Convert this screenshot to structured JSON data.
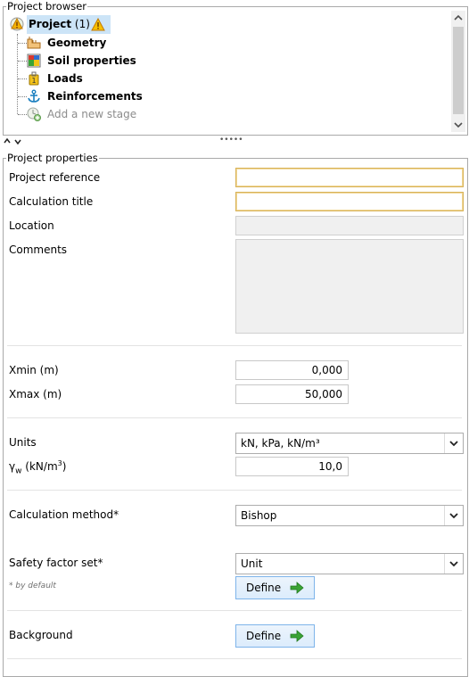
{
  "project_browser": {
    "legend": "Project browser",
    "root": {
      "label": "Project",
      "count": "(1)"
    },
    "items": [
      {
        "label": "Geometry",
        "icon": "geometry-icon"
      },
      {
        "label": "Soil properties",
        "icon": "soil-properties-icon"
      },
      {
        "label": "Loads",
        "icon": "loads-icon"
      },
      {
        "label": "Reinforcements",
        "icon": "anchor-icon"
      }
    ],
    "add_stage": "Add a new stage",
    "splitter": "•••••"
  },
  "project_properties": {
    "legend": "Project properties",
    "project_reference": {
      "label": "Project reference",
      "value": ""
    },
    "calculation_title": {
      "label": "Calculation title",
      "value": ""
    },
    "location": {
      "label": "Location",
      "value": ""
    },
    "comments": {
      "label": "Comments",
      "value": ""
    },
    "xmin": {
      "label": "Xmin (m)",
      "value": "0,000"
    },
    "xmax": {
      "label": "Xmax (m)",
      "value": "50,000"
    },
    "units": {
      "label": "Units",
      "value": "kN, kPa, kN/m³"
    },
    "gamma_w": {
      "label": "γ",
      "sub": "w",
      "unit_open": " (kN/m",
      "sup": "3",
      "unit_close": ")",
      "value": "10,0"
    },
    "calculation_method": {
      "label": "Calculation method*",
      "value": "Bishop"
    },
    "safety_factor_set": {
      "label": "Safety factor set*",
      "value": "Unit",
      "note": "* by default",
      "define": "Define"
    },
    "background": {
      "label": "Background",
      "define": "Define"
    }
  },
  "colors": {
    "highlight_border": "#d8b35a",
    "selection": "#cce4f7",
    "define_arrow": "#3aa335"
  }
}
